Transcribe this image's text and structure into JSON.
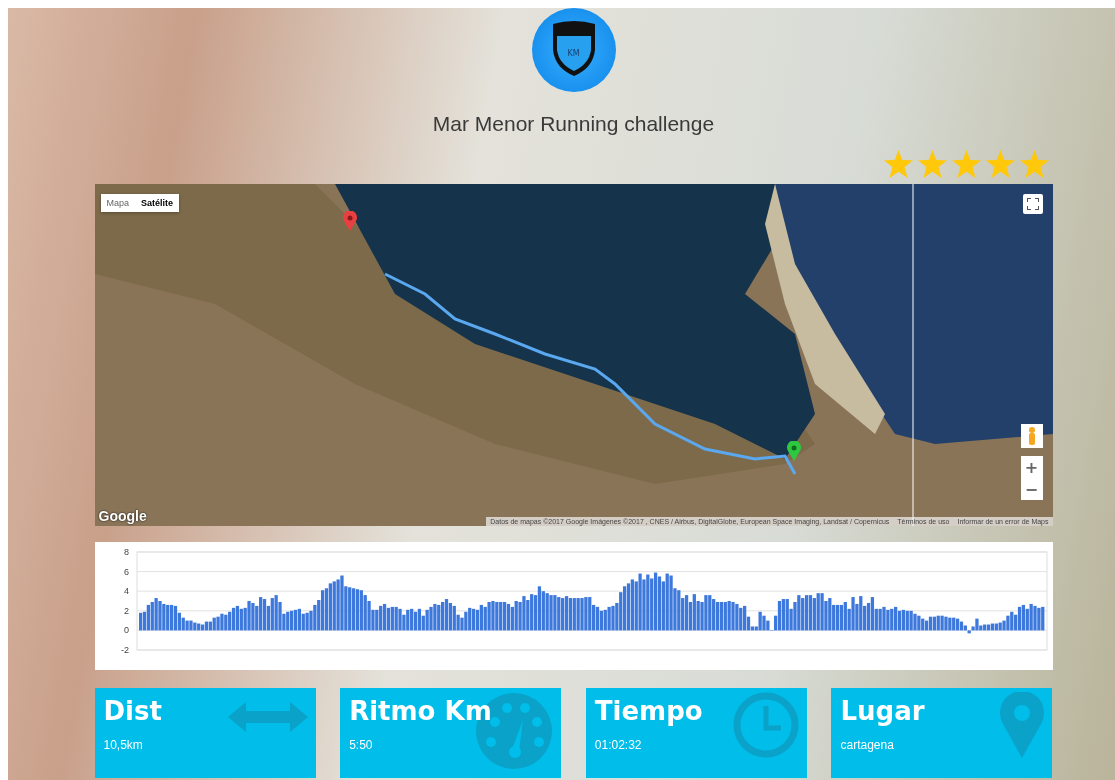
{
  "header": {
    "logo_text": "KM",
    "title": "Mar Menor Running challenge"
  },
  "rating": {
    "stars": 5
  },
  "map": {
    "map_types": [
      {
        "label": "Mapa",
        "selected": false
      },
      {
        "label": "Satélite",
        "selected": true
      }
    ],
    "logo": "Google",
    "attribution": "Datos de mapas ©2017 Google Imágenes ©2017 , CNES / Airbus, DigitalGlobe, European Space Imaging, Landsat / Copernicus",
    "terms": "Términos de uso",
    "report": "Informar de un error de Maps",
    "zoom_in": "+",
    "zoom_out": "−"
  },
  "chart": {
    "chart_data": {
      "type": "bar",
      "grid": true,
      "yticks": [
        -2,
        0,
        2,
        4,
        6,
        8
      ],
      "ylim": [
        -2,
        8
      ],
      "values": [
        1.8,
        1.9,
        2.6,
        2.9,
        3.3,
        3.0,
        2.7,
        2.6,
        2.6,
        2.5,
        1.8,
        1.3,
        1.0,
        1.0,
        0.8,
        0.7,
        0.6,
        0.9,
        0.9,
        1.3,
        1.4,
        1.7,
        1.6,
        1.9,
        2.3,
        2.5,
        2.2,
        2.3,
        3.0,
        2.8,
        2.5,
        3.4,
        3.2,
        2.5,
        3.3,
        3.6,
        2.9,
        1.7,
        1.9,
        2.0,
        2.1,
        2.2,
        1.7,
        1.8,
        2.0,
        2.6,
        3.1,
        4.1,
        4.3,
        4.8,
        5.0,
        5.2,
        5.6,
        4.5,
        4.4,
        4.3,
        4.2,
        4.1,
        3.6,
        3.0,
        2.1,
        2.1,
        2.5,
        2.7,
        2.3,
        2.4,
        2.4,
        2.2,
        1.6,
        2.1,
        2.2,
        1.9,
        2.2,
        1.5,
        2.1,
        2.4,
        2.7,
        2.6,
        2.9,
        3.2,
        2.8,
        2.5,
        1.6,
        1.3,
        1.9,
        2.3,
        2.2,
        2.1,
        2.6,
        2.4,
        2.9,
        3.0,
        2.9,
        2.9,
        2.9,
        2.7,
        2.4,
        3.0,
        2.9,
        3.5,
        3.1,
        3.7,
        3.6,
        4.5,
        4.0,
        3.8,
        3.6,
        3.6,
        3.4,
        3.3,
        3.5,
        3.3,
        3.3,
        3.3,
        3.3,
        3.4,
        3.4,
        2.6,
        2.4,
        2.0,
        2.1,
        2.4,
        2.5,
        2.8,
        3.9,
        4.5,
        4.8,
        5.2,
        5.0,
        5.8,
        5.2,
        5.7,
        5.3,
        5.9,
        5.5,
        5.0,
        5.8,
        5.6,
        4.3,
        4.1,
        3.3,
        3.6,
        2.9,
        3.7,
        3.0,
        2.9,
        3.6,
        3.6,
        3.2,
        2.9,
        2.9,
        2.9,
        3.0,
        2.9,
        2.7,
        2.3,
        2.5,
        1.4,
        0.4,
        0.4,
        1.9,
        1.5,
        1.0,
        0,
        1.5,
        3.0,
        3.2,
        3.2,
        2.2,
        2.9,
        3.6,
        3.3,
        3.6,
        3.6,
        3.3,
        3.8,
        3.8,
        3.0,
        3.3,
        2.6,
        2.6,
        2.6,
        2.9,
        2.2,
        3.4,
        2.7,
        3.5,
        2.5,
        2.8,
        3.4,
        2.2,
        2.2,
        2.4,
        2.1,
        2.2,
        2.4,
        2.0,
        2.1,
        2.0,
        2.0,
        1.7,
        1.5,
        1.2,
        1.0,
        1.4,
        1.4,
        1.5,
        1.5,
        1.4,
        1.3,
        1.3,
        1.2,
        0.9,
        0.5,
        -0.3,
        0.4,
        1.2,
        0.5,
        0.6,
        0.6,
        0.7,
        0.7,
        0.8,
        1.0,
        1.5,
        1.9,
        1.6,
        2.4,
        2.6,
        2.2,
        2.7,
        2.5,
        2.3,
        2.4
      ]
    }
  },
  "stats": [
    {
      "kind": "distance",
      "label": "Dist",
      "value": "10,5km"
    },
    {
      "kind": "pace",
      "label": "Ritmo Km",
      "value": "5:50"
    },
    {
      "kind": "time",
      "label": "Tiempo",
      "value": "01:02:32"
    },
    {
      "kind": "place",
      "label": "Lugar",
      "value": "cartagena"
    }
  ]
}
